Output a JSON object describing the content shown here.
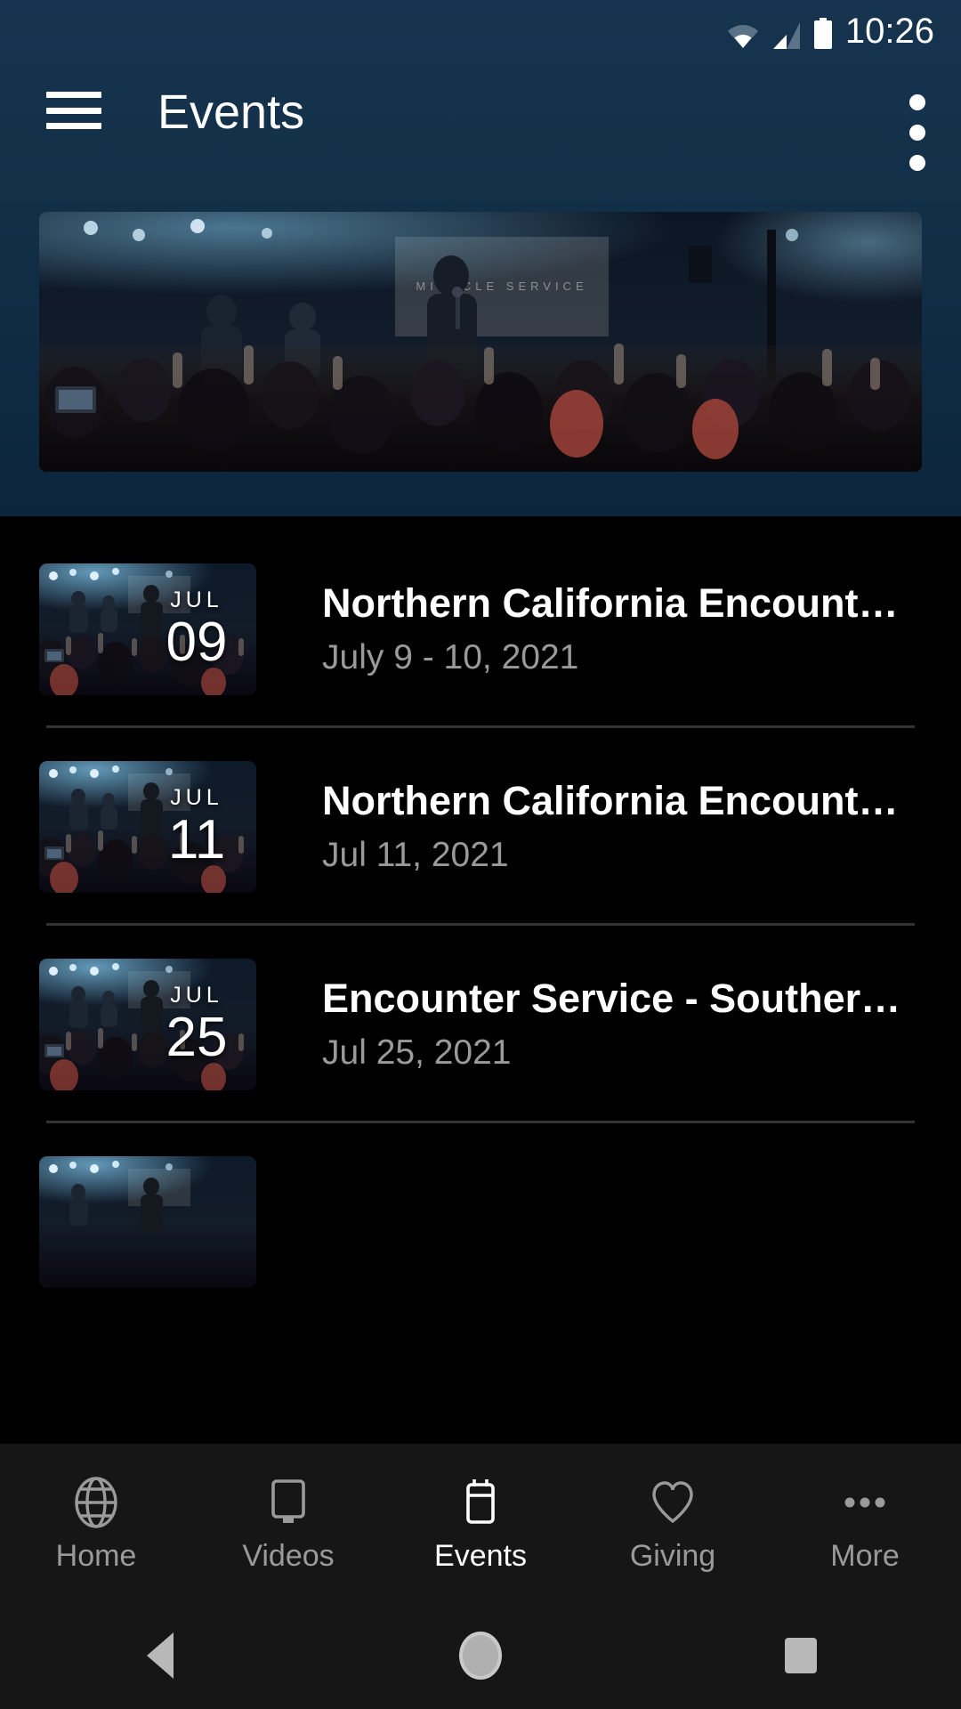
{
  "statusbar": {
    "time": "10:26",
    "icons": [
      "wifi-icon",
      "cellular-signal-icon",
      "battery-icon"
    ]
  },
  "appbar": {
    "menu_icon": "hamburger-menu-icon",
    "title": "Events",
    "overflow_icon": "overflow-menu-icon"
  },
  "hero": {
    "alt": "Church miracle service with crowd raising hands",
    "screen_text": "MIRACLE SERVICE"
  },
  "events": [
    {
      "month": "JUL",
      "day": "09",
      "title": "Northern California Encount…",
      "date": "July 9 - 10, 2021"
    },
    {
      "month": "JUL",
      "day": "11",
      "title": "Northern California Encount…",
      "date": "Jul 11, 2021"
    },
    {
      "month": "JUL",
      "day": "25",
      "title": "Encounter Service - Souther…",
      "date": "Jul 25, 2021"
    }
  ],
  "tabbar": {
    "items": [
      {
        "label": "Home",
        "icon": "globe-icon",
        "active": false
      },
      {
        "label": "Videos",
        "icon": "monitor-icon",
        "active": false
      },
      {
        "label": "Events",
        "icon": "calendar-icon",
        "active": true
      },
      {
        "label": "Giving",
        "icon": "heart-icon",
        "active": false
      },
      {
        "label": "More",
        "icon": "ellipsis-icon",
        "active": false
      }
    ]
  },
  "navbar": {
    "back": "back-triangle-icon",
    "home": "home-circle-icon",
    "recents": "recents-square-icon"
  },
  "colors": {
    "header_blue": "#133049",
    "background": "#000000",
    "tabbar": "#161616",
    "active_tab": "#ffffff",
    "inactive_tab": "#9a9a9a",
    "secondary_text": "#9a9a9a",
    "divider": "#333333"
  }
}
